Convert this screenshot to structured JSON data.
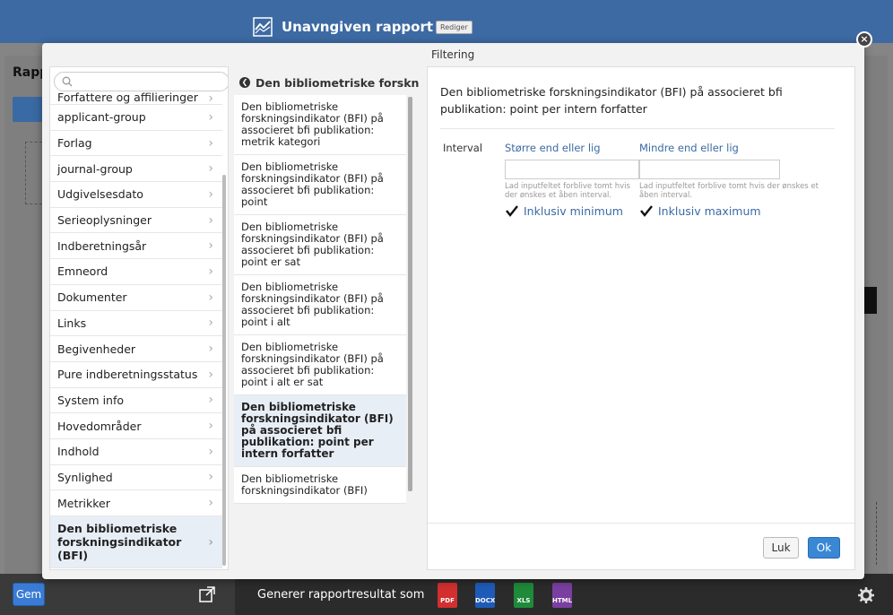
{
  "header": {
    "title": "Unavngiven rapport",
    "edit_badge": "Rediger"
  },
  "background": {
    "page_title_fragment": "Rapp"
  },
  "modal": {
    "panel_title": "Filtering",
    "search": {
      "placeholder": ""
    },
    "left_list": [
      {
        "label": "Forfattere og affilieringer",
        "partial": true
      },
      {
        "label": "applicant-group"
      },
      {
        "label": "Forlag"
      },
      {
        "label": "journal-group"
      },
      {
        "label": "Udgivelsesdato"
      },
      {
        "label": "Serieoplysninger"
      },
      {
        "label": "Indberetningsår"
      },
      {
        "label": "Emneord"
      },
      {
        "label": "Dokumenter"
      },
      {
        "label": "Links"
      },
      {
        "label": "Begivenheder"
      },
      {
        "label": "Pure indberetningsstatus"
      },
      {
        "label": "System info"
      },
      {
        "label": "Hovedområder"
      },
      {
        "label": "Indhold"
      },
      {
        "label": "Synlighed"
      },
      {
        "label": "Metrikker"
      },
      {
        "label": "Den bibliometriske forskningsindikator (BFI)",
        "selected": true
      }
    ],
    "middle_header": "Den bibliometriske forskn",
    "middle_list": [
      {
        "label": "Den bibliometriske forskningsindikator (BFI) på associeret bfi publikation: metrik kategori"
      },
      {
        "label": "Den bibliometriske forskningsindikator (BFI) på associeret bfi publikation: point"
      },
      {
        "label": "Den bibliometriske forskningsindikator (BFI) på associeret bfi publikation: point er sat"
      },
      {
        "label": "Den bibliometriske forskningsindikator (BFI) på associeret bfi publikation: point i alt"
      },
      {
        "label": "Den bibliometriske forskningsindikator (BFI) på associeret bfi publikation: point i alt er sat"
      },
      {
        "label": "Den bibliometriske forskningsindikator (BFI) på associeret bfi publikation: point per intern forfatter",
        "selected": true
      },
      {
        "label": "Den bibliometriske forskningsindikator (BFI)",
        "partial": true
      }
    ],
    "detail": {
      "heading": "Den bibliometriske forskningsindikator (BFI) på associeret bfi publikation: point per intern forfatter",
      "interval_label": "Interval",
      "min": {
        "label": "Større end eller lig",
        "value": "",
        "help": "Lad inputfeltet forblive tomt hvis der ønskes et åben interval.",
        "check_label": "Inklusiv minimum",
        "checked": true
      },
      "max": {
        "label": "Mindre end eller lig",
        "value": "",
        "help": "Lad inputfeltet forblive tomt hvis der ønskes et åben interval.",
        "check_label": "Inklusiv maximum",
        "checked": true
      },
      "close_button": "Luk",
      "ok_button": "Ok"
    }
  },
  "footer": {
    "save_label": "Gem",
    "generate_label": "Generer rapportresultat som",
    "formats": [
      {
        "label": "PDF",
        "color": "#d32f2f"
      },
      {
        "label": "DOCX",
        "color": "#1e5bb8"
      },
      {
        "label": "XLS",
        "color": "#1f8a3a"
      },
      {
        "label": "HTML",
        "color": "#7a3fa0"
      }
    ]
  },
  "colors": {
    "brand_blue": "#3d6aa3",
    "link_blue": "#3a6aa3",
    "selection_bg": "#e8eef6"
  }
}
